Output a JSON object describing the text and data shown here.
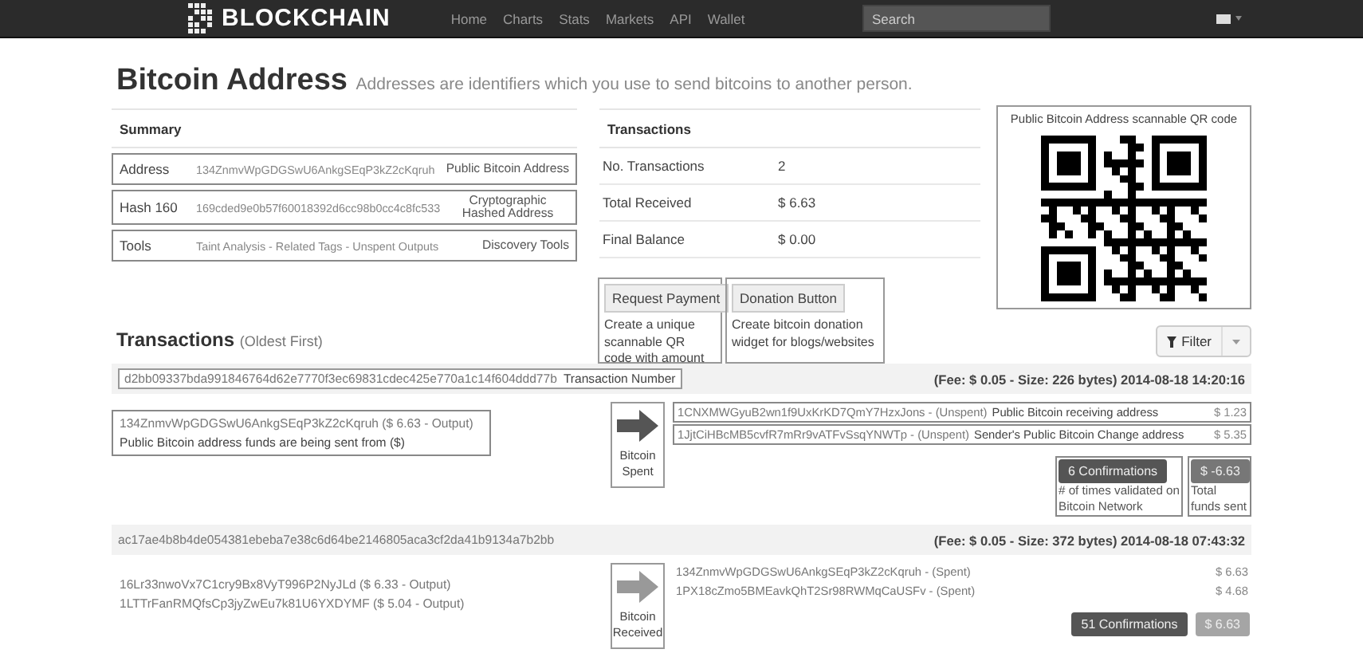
{
  "nav": {
    "logo": "BLOCKCHAIN",
    "links": [
      "Home",
      "Charts",
      "Stats",
      "Markets",
      "API",
      "Wallet"
    ],
    "search": {
      "placeholder": "Search"
    }
  },
  "title": "Bitcoin Address",
  "subtitle": "Addresses are identifiers which you use to send bitcoins to another person.",
  "summary": {
    "heading": "Summary",
    "rows": [
      {
        "label": "Address",
        "value": "134ZnmvWpGDGSwU6AnkgSEqP3kZ2cKqruh",
        "note": "Public Bitcoin Address"
      },
      {
        "label": "Hash 160",
        "value": "169cded9e0b57f60018392d6cc98b0cc4c8fc533",
        "note": "Cryptographic Hashed Address"
      },
      {
        "label": "Tools",
        "value": "Taint Analysis - Related Tags - Unspent Outputs",
        "note": "Discovery Tools"
      }
    ]
  },
  "transactions_table": {
    "heading": "Transactions",
    "rows": [
      {
        "label": "No. Transactions",
        "value": "2"
      },
      {
        "label": "Total Received",
        "value": "$ 6.63"
      },
      {
        "label": "Final Balance",
        "value": "$ 0.00"
      }
    ]
  },
  "actions": [
    {
      "label": "Request Payment",
      "note": "Create a unique scannable QR code with amount"
    },
    {
      "label": "Donation Button",
      "note": "Create bitcoin donation widget for blogs/websites"
    }
  ],
  "qr": {
    "caption": "Public Bitcoin Address scannable QR code"
  },
  "transactions_heading": {
    "title": "Transactions",
    "suffix": "(Oldest First)"
  },
  "filter": {
    "label": "Filter"
  },
  "transactions": [
    {
      "hash": "d2bb09337bda991846764d62e7770f3ec69831cdec425e770a1c14f604ddd77b",
      "hash_note": "Transaction Number",
      "fee": "(Fee: $ 0.05 - Size: 226 bytes) 2014-08-18 14:20:16",
      "kind": "spent",
      "direction_label": "Bitcoin Spent",
      "inputs": [
        "134ZnmvWpGDGSwU6AnkgSEqP3kZ2cKqruh ($ 6.63 - Output)"
      ],
      "inputs_note": "Public Bitcoin address funds are being sent from ($)",
      "outputs": [
        {
          "address": "1CNXMWGyuB2wn1f9UxKrKD7QmY7HzxJons - (Unspent)",
          "note": "Public Bitcoin receiving address",
          "amount": "$ 1.23"
        },
        {
          "address": "1JjtCiHBcMB5cvfR7mRr9vATFvSsqYNWTp - (Unspent)",
          "note": "Sender's Public Bitcoin Change address",
          "amount": "$ 5.35"
        }
      ],
      "confirmations": "6 Confirmations",
      "confirmations_note": "# of times validated on Bitcoin Network",
      "total": "$ -6.63",
      "total_note": "Total funds sent"
    },
    {
      "hash": "ac17ae4b8b4de054381ebeba7e38c6d64be2146805aca3cf2da41b9134a7b2bb",
      "fee": "(Fee: $ 0.05 - Size: 372 bytes) 2014-08-18 07:43:32",
      "kind": "received",
      "direction_label": "Bitcoin Received",
      "inputs": [
        "16Lr33nwoVx7C1cry9Bx8VyT996P2NyJLd ($ 6.33 - Output)",
        "1LTTrFanRMQfsCp3jyZwEu7k81U6YXDYMF ($ 5.04 - Output)"
      ],
      "outputs": [
        {
          "address": "134ZnmvWpGDGSwU6AnkgSEqP3kZ2cKqruh - (Spent)",
          "amount": "$ 6.63"
        },
        {
          "address": "1PX18cZmo5BMEavkQhT2Sr98RWMqCaUSFv - (Spent)",
          "amount": "$ 4.68"
        }
      ],
      "confirmations": "51 Confirmations",
      "total": "$ 6.63"
    }
  ]
}
